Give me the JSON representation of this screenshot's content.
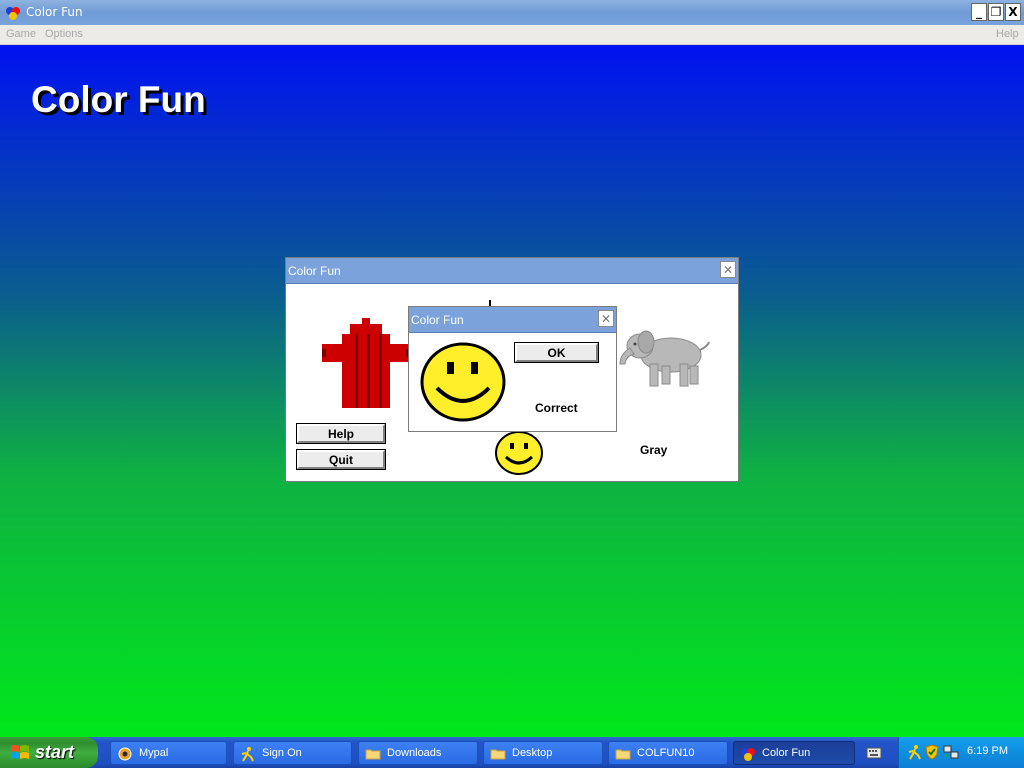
{
  "window": {
    "title": "Color Fun",
    "controls": {
      "minimize": "_",
      "restore": "❐",
      "close": "X"
    }
  },
  "menu": {
    "game": "Game",
    "options": "Options",
    "help": "Help"
  },
  "content": {
    "title": "Color Fun"
  },
  "main_dialog": {
    "title": "Color Fun",
    "close": "✕",
    "help_button": "Help",
    "quit_button": "Quit",
    "answer_label": "Gray"
  },
  "result_dialog": {
    "title": "Color Fun",
    "close": "✕",
    "ok_button": "OK",
    "message": "Correct"
  },
  "taskbar": {
    "start_label": "start",
    "tasks": [
      {
        "label": "Mypal",
        "icon": "mypal-icon"
      },
      {
        "label": "Sign On",
        "icon": "aim-icon"
      },
      {
        "label": "Downloads",
        "icon": "folder-icon"
      },
      {
        "label": "Desktop",
        "icon": "folder-icon"
      },
      {
        "label": "COLFUN10",
        "icon": "folder-icon"
      },
      {
        "label": "Color Fun",
        "icon": "color-fun-icon",
        "active": true
      }
    ],
    "clock": "6:19 PM"
  },
  "colors": {
    "accent_titlebar": "#7ba2da",
    "hydrant": "#cc0000",
    "smiley": "#ffef2a",
    "elephant": "#b8b8b8"
  }
}
